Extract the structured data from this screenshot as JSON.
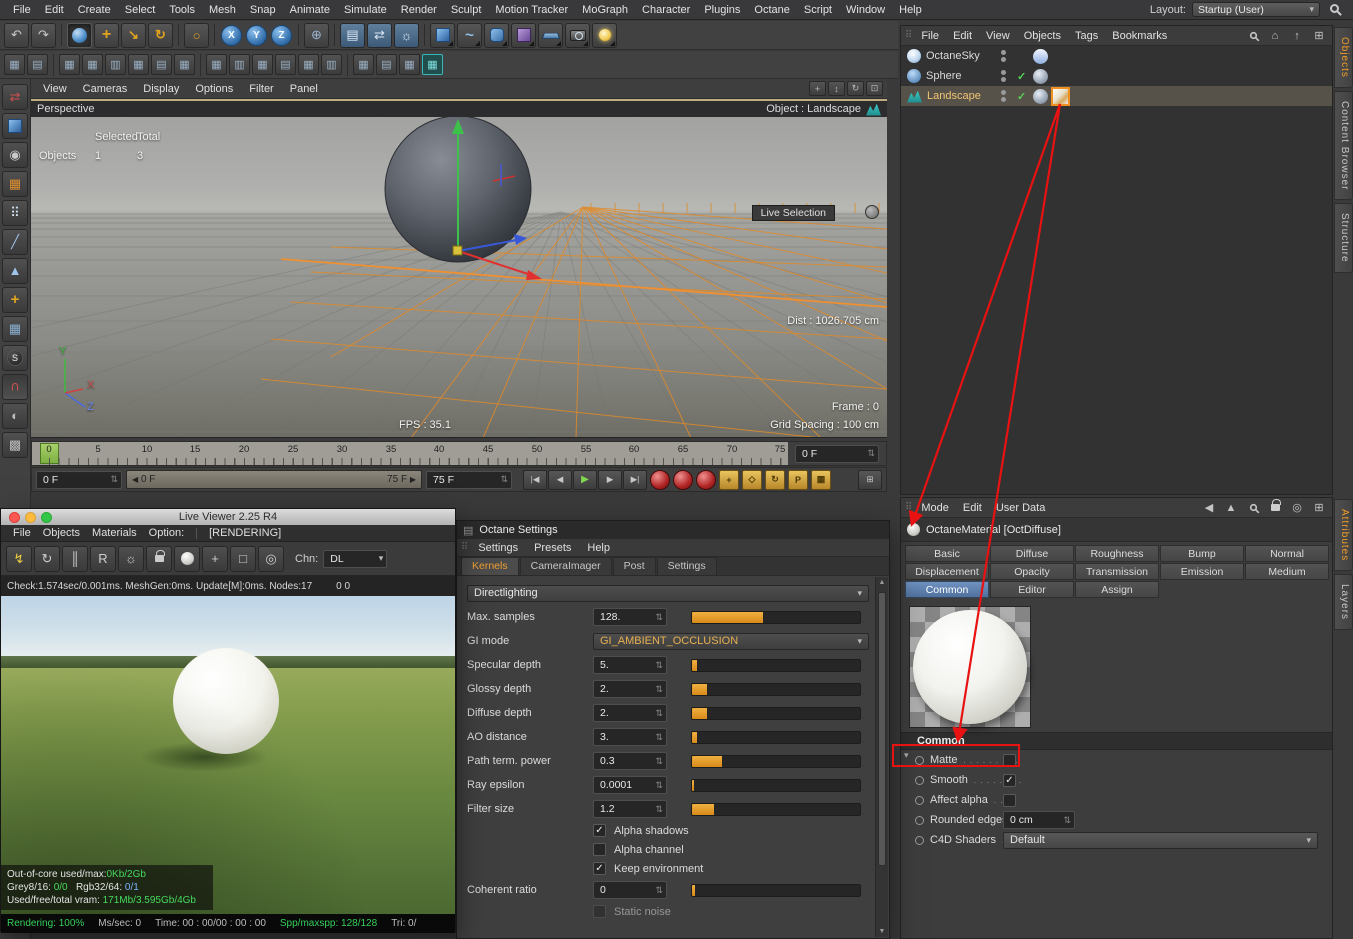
{
  "menubar": {
    "items": [
      "File",
      "Edit",
      "Create",
      "Select",
      "Tools",
      "Mesh",
      "Snap",
      "Animate",
      "Simulate",
      "Render",
      "Sculpt",
      "Motion Tracker",
      "MoGraph",
      "Character",
      "Plugins",
      "Octane",
      "Script",
      "Window",
      "Help"
    ],
    "layout_label": "Layout:",
    "layout_value": "Startup (User)"
  },
  "viewport": {
    "menu": [
      "View",
      "Cameras",
      "Display",
      "Options",
      "Filter",
      "Panel"
    ],
    "view_name": "Perspective",
    "object_label": "Object : Landscape",
    "hud": {
      "selected_header": "Selected",
      "total_header": "Total",
      "row_label": "Objects",
      "selected": "1",
      "total": "3"
    },
    "live_selection_label": "Live Selection",
    "dist_label": "Dist : 1026.705 cm",
    "frame_label": "Frame : 0",
    "grid_spacing_label": "Grid Spacing : 100 cm",
    "fps_label": "FPS : 35.1",
    "axis": {
      "x": "X",
      "y": "Y",
      "z": "Z"
    }
  },
  "timeline": {
    "ticks": [
      "0",
      "5",
      "10",
      "15",
      "20",
      "25",
      "30",
      "35",
      "40",
      "45",
      "50",
      "55",
      "60",
      "65",
      "70",
      "75"
    ],
    "current_frame": "0 F",
    "range_start": "0 F",
    "range_end": "75 F",
    "end_frame": "75 F"
  },
  "live_viewer": {
    "title": "Live Viewer 2.25 R4",
    "menu": [
      "File",
      "Objects",
      "Materials",
      "Option:",
      "[RENDERING]"
    ],
    "channel_label": "Chn:",
    "channel_value": "DL",
    "status_a": "Check:1.574sec/0.001ms. MeshGen:0ms. Update[M]:0ms. Nodes:17",
    "status_b": "0 0",
    "overlay": {
      "l1_label": "Out-of-core used/max:",
      "l1_value": "0Kb/2Gb",
      "l2_label_a": "Grey8/16:",
      "l2_value_a": "0/0",
      "l2_label_b": "Rgb32/64:",
      "l2_value_b": "0/1",
      "l3_label": "Used/free/total vram:",
      "l3_value": "171Mb/3.595Gb/4Gb"
    },
    "footer": {
      "rendering": "Rendering: 100%",
      "mssec": "Ms/sec: 0",
      "time": "Time: 00 : 00/00 : 00 : 00",
      "spp": "Spp/maxspp: 128/128",
      "tri": "Tri: 0/"
    }
  },
  "octane": {
    "title": "Octane Settings",
    "menu": [
      "Settings",
      "Presets",
      "Help"
    ],
    "tabs": [
      "Kernels",
      "CameraImager",
      "Post",
      "Settings"
    ],
    "kernel": "Directlighting",
    "gi_label": "GI mode",
    "gi_value": "GI_AMBIENT_OCCLUSION",
    "params": [
      {
        "label": "Max. samples",
        "value": "128.",
        "fill": 0.42
      },
      {
        "label": "Specular depth",
        "value": "5.",
        "fill": 0.03
      },
      {
        "label": "Glossy depth",
        "value": "2.",
        "fill": 0.09
      },
      {
        "label": "Diffuse depth",
        "value": "2.",
        "fill": 0.09
      },
      {
        "label": "AO distance",
        "value": "3.",
        "fill": 0.03
      },
      {
        "label": "Path term. power",
        "value": "0.3",
        "fill": 0.18
      },
      {
        "label": "Ray epsilon",
        "value": "0.0001",
        "fill": 0.01
      },
      {
        "label": "Filter size",
        "value": "1.2",
        "fill": 0.13
      },
      {
        "label": "Coherent ratio",
        "value": "0",
        "fill": 0.02
      }
    ],
    "checks": [
      {
        "label": "Alpha shadows",
        "mark": "✓"
      },
      {
        "label": "Alpha channel",
        "mark": ""
      },
      {
        "label": "Keep environment",
        "mark": "✓"
      }
    ],
    "partial_check": {
      "label": "Static noise",
      "mark": ""
    }
  },
  "object_manager": {
    "menu": [
      "File",
      "Edit",
      "View",
      "Objects",
      "Tags",
      "Bookmarks"
    ],
    "items": [
      {
        "name": "OctaneSky",
        "enabled": ""
      },
      {
        "name": "Sphere",
        "enabled": "✓"
      },
      {
        "name": "Landscape",
        "enabled": "✓"
      }
    ]
  },
  "attribute_manager": {
    "menu": [
      "Mode",
      "Edit",
      "User Data"
    ],
    "material_title": "OctaneMaterial [OctDiffuse]",
    "tabs_row1": [
      "Basic",
      "Diffuse",
      "Roughness",
      "Bump",
      "Normal"
    ],
    "tabs_row2": [
      "Displacement",
      "Opacity",
      "Transmission",
      "Emission",
      "Medium"
    ],
    "tabs_row3": [
      "Common",
      "Editor",
      "Assign"
    ],
    "section": "Common",
    "props": [
      {
        "label": "Matte",
        "leader": ". . . . . . . . .",
        "mark": ""
      },
      {
        "label": "Smooth",
        "leader": ". . . . . . . .",
        "mark": "✓"
      },
      {
        "label": "Affect alpha",
        "leader": ". . . .",
        "mark": ""
      },
      {
        "label": "Rounded edges",
        "value": "0 cm"
      },
      {
        "label": "C4D Shaders",
        "leader": ". . .",
        "value": "Default"
      }
    ]
  },
  "right_tabs": {
    "top": [
      "Objects",
      "Content Browser",
      "Structure"
    ],
    "bottom": [
      "Attributes",
      "Layers"
    ]
  },
  "colors": {
    "accent_orange": "#e89c2e",
    "tab_blue": "#5b80ab",
    "annotation_red": "#e81212"
  }
}
